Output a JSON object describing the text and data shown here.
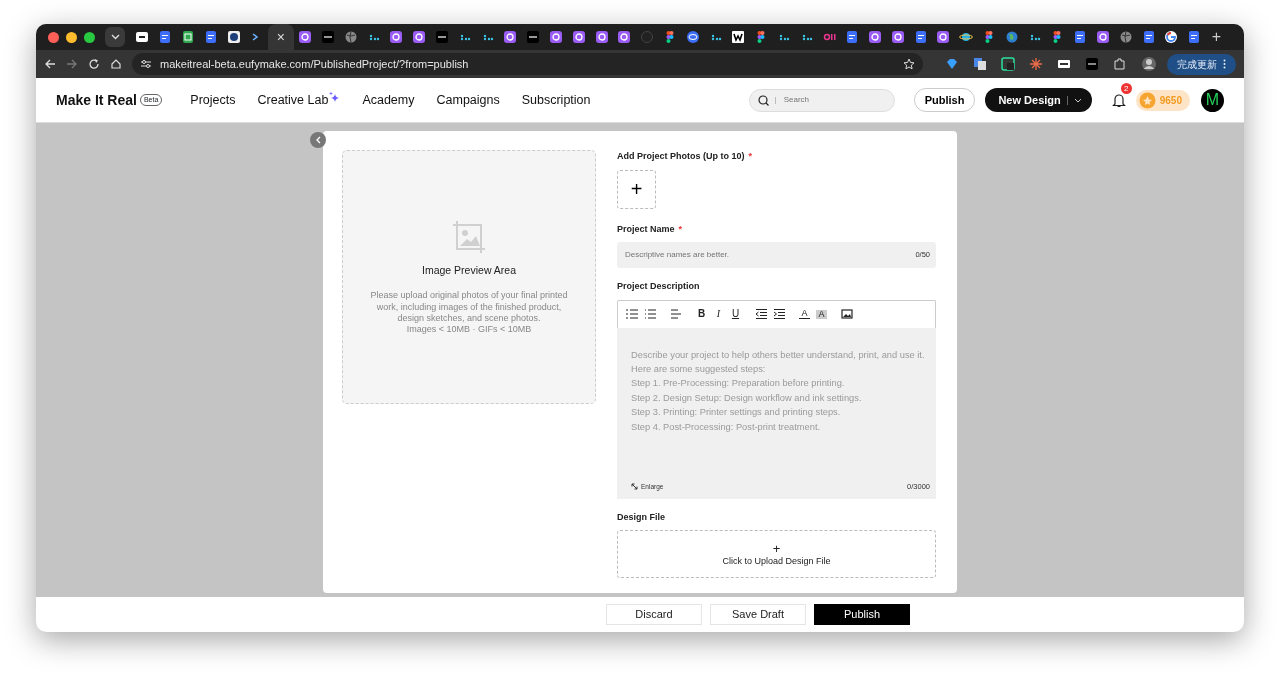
{
  "browser": {
    "tabs": [
      {
        "kind": "blank",
        "selected": false
      },
      {
        "kind": "doc",
        "selected": false
      },
      {
        "kind": "sheet",
        "selected": false
      },
      {
        "kind": "doc",
        "selected": false
      },
      {
        "kind": "image",
        "selected": false
      },
      {
        "kind": "terminal",
        "selected": false
      },
      {
        "selected": true
      },
      {
        "kind": "purple",
        "selected": false
      },
      {
        "kind": "dark",
        "selected": false
      },
      {
        "kind": "globe",
        "selected": false
      },
      {
        "kind": "dots",
        "selected": false
      },
      {
        "kind": "purple",
        "selected": false
      },
      {
        "kind": "purple",
        "selected": false
      },
      {
        "kind": "dark",
        "selected": false
      },
      {
        "kind": "dots",
        "selected": false
      },
      {
        "kind": "dots",
        "selected": false
      },
      {
        "kind": "purple",
        "selected": false
      },
      {
        "kind": "dark",
        "selected": false
      },
      {
        "kind": "purple",
        "selected": false
      },
      {
        "kind": "purple",
        "selected": false
      },
      {
        "kind": "purple",
        "selected": false
      },
      {
        "kind": "purple",
        "selected": false
      },
      {
        "kind": "github",
        "selected": false
      },
      {
        "kind": "figma",
        "selected": false
      },
      {
        "kind": "eye",
        "selected": false
      },
      {
        "kind": "dots",
        "selected": false
      },
      {
        "kind": "w",
        "selected": false
      },
      {
        "kind": "figma",
        "selected": false
      },
      {
        "kind": "dots",
        "selected": false
      },
      {
        "kind": "dots",
        "selected": false
      },
      {
        "kind": "pink",
        "selected": false
      },
      {
        "kind": "doc",
        "selected": false
      },
      {
        "kind": "purple",
        "selected": false
      },
      {
        "kind": "purple",
        "selected": false
      },
      {
        "kind": "doc",
        "selected": false
      },
      {
        "kind": "purple",
        "selected": false
      },
      {
        "kind": "planet",
        "selected": false
      },
      {
        "kind": "figma",
        "selected": false
      },
      {
        "kind": "earth",
        "selected": false
      },
      {
        "kind": "dots",
        "selected": false
      },
      {
        "kind": "figma",
        "selected": false
      },
      {
        "kind": "doc",
        "selected": false
      },
      {
        "kind": "purple",
        "selected": false
      },
      {
        "kind": "globe",
        "selected": false
      },
      {
        "kind": "doc",
        "selected": false
      },
      {
        "kind": "google",
        "selected": false
      },
      {
        "kind": "doc",
        "selected": false
      }
    ],
    "tab_close": "×",
    "new_tab": "+",
    "url": "makeitreal-beta.eufymake.com/PublishedProject/?from=publish",
    "update_button": "完成更新"
  },
  "header": {
    "logo": "Make It Real",
    "logo_badge": "Beta",
    "nav": [
      {
        "label": "Projects",
        "kind": "plain"
      },
      {
        "label": "Creative Lab",
        "kind": "sparkle"
      },
      {
        "label": "Academy",
        "kind": "plain"
      },
      {
        "label": "Campaigns",
        "kind": "plain"
      },
      {
        "label": "Subscription",
        "kind": "plain"
      }
    ],
    "search": {
      "placeholder": "Search"
    },
    "publish": "Publish",
    "new_design": "New Design",
    "notifications": "2",
    "coins": "9650",
    "avatar": "M"
  },
  "preview": {
    "title": "Image Preview Area",
    "text": "Please upload original photos of your final printed work, including images of the finished product, design sketches, and scene photos.",
    "limits": "Images < 10MB · GIFs < 10MB"
  },
  "form": {
    "required_mark": "*",
    "photos_label": "Add Project Photos (Up to 10)",
    "photos_required": true,
    "photos_add": "+",
    "name_label": "Project Name",
    "name_required": true,
    "name": {
      "placeholder": "Descriptive names are better.",
      "counter": "0/50"
    },
    "description_label": "Project Description",
    "toolbar": [
      [
        {
          "kind": "ordered-list"
        },
        {
          "kind": "bullet-list"
        }
      ],
      [
        {
          "kind": "align"
        }
      ],
      [
        {
          "kind": "bold",
          "label": "B"
        },
        {
          "kind": "italic",
          "label": "I"
        },
        {
          "kind": "underline",
          "label": "U"
        }
      ],
      [
        {
          "kind": "outdent"
        },
        {
          "kind": "indent"
        }
      ],
      [
        {
          "kind": "font-color",
          "label": "A"
        },
        {
          "kind": "highlight",
          "label": "A"
        }
      ],
      [
        {
          "kind": "image"
        }
      ]
    ],
    "description": {
      "placeholder": "Describe your project to help others better understand, print, and use it.\nHere are some suggested steps:\nStep 1. Pre-Processing: Preparation before printing.\nStep 2. Design Setup: Design workflow and ink settings.\nStep 3. Printing: Printer settings and printing steps.\nStep 4. Post-Processing: Post-print treatment.",
      "enlarge": "Enlarge",
      "counter": "0/3000"
    },
    "file_label": "Design File",
    "file_add": "+",
    "file_text": "Click to Upload Design File"
  },
  "footer": {
    "buttons": [
      {
        "label": "Discard",
        "kind": "outline"
      },
      {
        "label": "Save Draft",
        "kind": "outline"
      },
      {
        "label": "Publish",
        "kind": "primary"
      }
    ]
  }
}
